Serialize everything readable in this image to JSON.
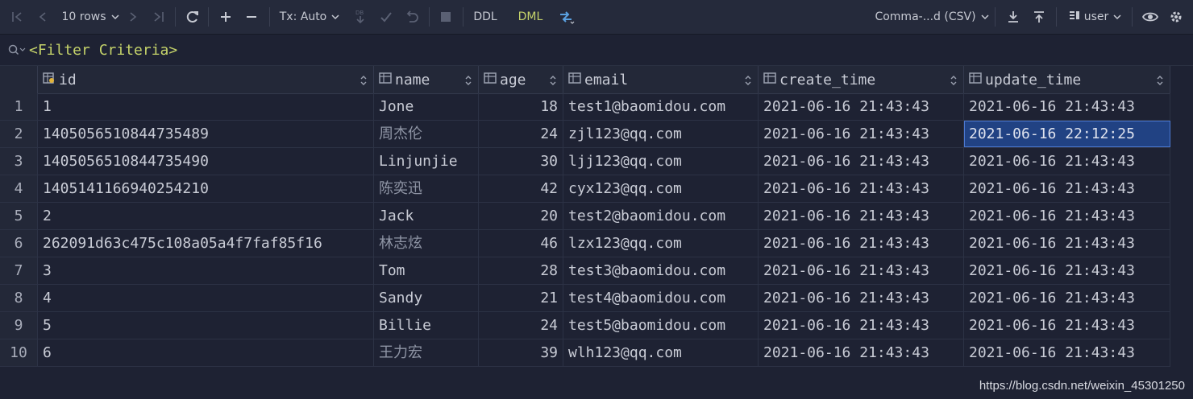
{
  "toolbar": {
    "rows_label": "10 rows",
    "tx_label": "Tx: Auto",
    "ddl_label": "DDL",
    "dml_label": "DML",
    "export_format": "Comma-...d (CSV)",
    "schema_label": "user",
    "db_badge": "DB",
    "accent_dml": "#c5d36a"
  },
  "filter": {
    "placeholder": "<Filter Criteria>"
  },
  "columns": [
    {
      "name": "id",
      "icon": "key-column-icon"
    },
    {
      "name": "name",
      "icon": "column-icon"
    },
    {
      "name": "age",
      "icon": "column-icon"
    },
    {
      "name": "email",
      "icon": "column-icon"
    },
    {
      "name": "create_time",
      "icon": "column-icon"
    },
    {
      "name": "update_time",
      "icon": "column-icon"
    }
  ],
  "rows": [
    {
      "n": "1",
      "id": "1",
      "name": "Jone",
      "age": "18",
      "email": "test1@baomidou.com",
      "create_time": "2021-06-16 21:43:43",
      "update_time": "2021-06-16 21:43:43"
    },
    {
      "n": "2",
      "id": "1405056510844735489",
      "name": "周杰伦",
      "age": "24",
      "email": "zjl123@qq.com",
      "create_time": "2021-06-16 21:43:43",
      "update_time": "2021-06-16 22:12:25"
    },
    {
      "n": "3",
      "id": "1405056510844735490",
      "name": "Linjunjie",
      "age": "30",
      "email": "ljj123@qq.com",
      "create_time": "2021-06-16 21:43:43",
      "update_time": "2021-06-16 21:43:43"
    },
    {
      "n": "4",
      "id": "1405141166940254210",
      "name": "陈奕迅",
      "age": "42",
      "email": "cyx123@qq.com",
      "create_time": "2021-06-16 21:43:43",
      "update_time": "2021-06-16 21:43:43"
    },
    {
      "n": "5",
      "id": "2",
      "name": "Jack",
      "age": "20",
      "email": "test2@baomidou.com",
      "create_time": "2021-06-16 21:43:43",
      "update_time": "2021-06-16 21:43:43"
    },
    {
      "n": "6",
      "id": "262091d63c475c108a05a4f7faf85f16",
      "name": "林志炫",
      "age": "46",
      "email": "lzx123@qq.com",
      "create_time": "2021-06-16 21:43:43",
      "update_time": "2021-06-16 21:43:43"
    },
    {
      "n": "7",
      "id": "3",
      "name": "Tom",
      "age": "28",
      "email": "test3@baomidou.com",
      "create_time": "2021-06-16 21:43:43",
      "update_time": "2021-06-16 21:43:43"
    },
    {
      "n": "8",
      "id": "4",
      "name": "Sandy",
      "age": "21",
      "email": "test4@baomidou.com",
      "create_time": "2021-06-16 21:43:43",
      "update_time": "2021-06-16 21:43:43"
    },
    {
      "n": "9",
      "id": "5",
      "name": "Billie",
      "age": "24",
      "email": "test5@baomidou.com",
      "create_time": "2021-06-16 21:43:43",
      "update_time": "2021-06-16 21:43:43"
    },
    {
      "n": "10",
      "id": "6",
      "name": "王力宏",
      "age": "39",
      "email": "wlh123@qq.com",
      "create_time": "2021-06-16 21:43:43",
      "update_time": "2021-06-16 21:43:43"
    }
  ],
  "selected_cell": {
    "row": 1,
    "column": "update_time"
  },
  "watermark": "https://blog.csdn.net/weixin_45301250"
}
